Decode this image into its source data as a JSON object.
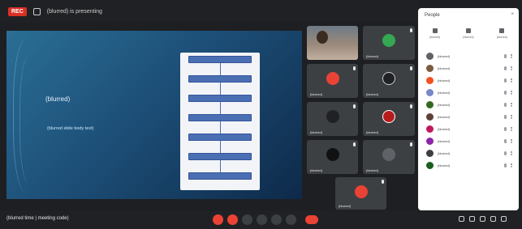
{
  "topbar": {
    "recording_badge": "REC",
    "presenting_label": "(blurred) is presenting"
  },
  "slide": {
    "heading": "(blurred)",
    "body": "(blurred slide body text)",
    "flow_steps": [
      "",
      "",
      "",
      "",
      "",
      "",
      ""
    ]
  },
  "tiles": [
    {
      "name": "(blurred)",
      "avatar_color": "#34a853"
    },
    {
      "name": "(blurred)",
      "avatar_color": "#ea4335"
    },
    {
      "name": "(blurred)",
      "avatar_color": "#202124"
    },
    {
      "name": "(blurred)",
      "avatar_color": "#202124"
    },
    {
      "name": "(blurred)",
      "avatar_color": "#b71c1c"
    },
    {
      "name": "(blurred)",
      "avatar_color": "#111111"
    },
    {
      "name": "(blurred)",
      "avatar_color": "#5f6368"
    },
    {
      "name": "(blurred)",
      "avatar_color": "#ea4335"
    }
  ],
  "bottom": {
    "meeting_info": "(blurred time | meeting code)"
  },
  "panel": {
    "title": "People",
    "close_glyph": "×",
    "actions": [
      "(blurred)",
      "(blurred)",
      "(blurred)"
    ],
    "participants": [
      {
        "name": "(blurred)",
        "avatar_color": "#5f6368"
      },
      {
        "name": "(blurred)",
        "avatar_color": "#7b5a3e"
      },
      {
        "name": "(blurred)",
        "avatar_color": "#f4511e"
      },
      {
        "name": "(blurred)",
        "avatar_color": "#7986cb"
      },
      {
        "name": "(blurred)",
        "avatar_color": "#33691e"
      },
      {
        "name": "(blurred)",
        "avatar_color": "#5d4037"
      },
      {
        "name": "(blurred)",
        "avatar_color": "#c2185b"
      },
      {
        "name": "(blurred)",
        "avatar_color": "#8e24aa"
      },
      {
        "name": "(blurred)",
        "avatar_color": "#3c4043"
      },
      {
        "name": "(blurred)",
        "avatar_color": "#1b5e20"
      }
    ]
  }
}
